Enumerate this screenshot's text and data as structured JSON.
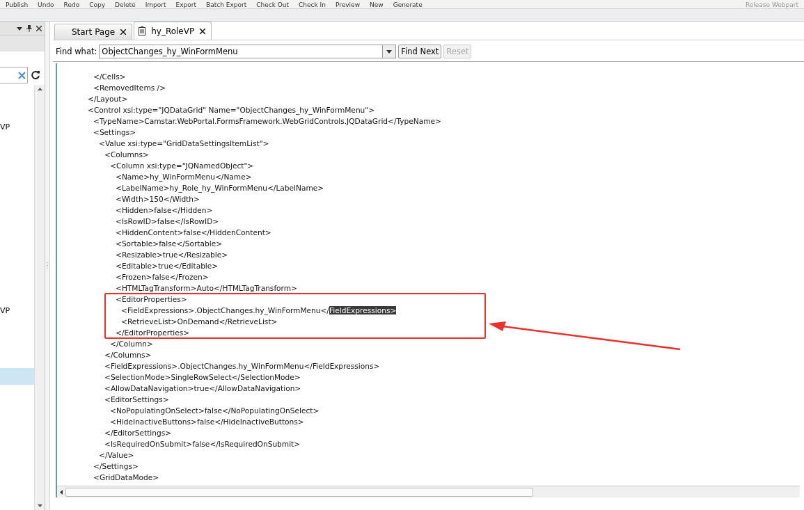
{
  "toolbar": {
    "items": [
      "Publish",
      "Undo",
      "Redo",
      "Copy",
      "Delete",
      "Import",
      "Export",
      "Batch Export",
      "Check Out",
      "Check In",
      "Preview",
      "New",
      "Generate"
    ],
    "right_item": "Release Webpart"
  },
  "side_panel": {
    "items": [
      {
        "label": "VP",
        "selected": false
      },
      {
        "label": "VP",
        "selected": false
      },
      {
        "selected": true
      }
    ]
  },
  "tabs": [
    {
      "label": "Start Page",
      "selected": false,
      "kind": "page"
    },
    {
      "label": "hy_RoleVP",
      "selected": true,
      "kind": "document"
    }
  ],
  "find_bar": {
    "label": "Find what:",
    "value": "ObjectChanges_hy_WinFormMenu",
    "buttons": [
      {
        "label": "Find Next",
        "disabled": false
      },
      {
        "label": "Reset",
        "disabled": true
      }
    ]
  },
  "code": [
    {
      "closing": "</Layout>",
      "children": [
        {
          "text": "</Cells>"
        },
        {
          "text": "<RemovedItems />"
        }
      ]
    },
    {
      "text": "<Control xsi:type=\"JQDataGrid\" Name=\"ObjectChanges_hy_WinFormMenu\">",
      "children": [
        {
          "text": "<TypeName>Camstar.WebPortal.FormsFramework.WebGridControls.JQDataGrid</TypeName>"
        },
        {
          "text": "<Settings>",
          "closing": "</Settings>",
          "children": [
            {
              "text": "<Value xsi:type=\"GridDataSettingsItemList\">",
              "closing": "</Value>",
              "children": [
                {
                  "text": "<Columns>",
                  "closing": "</Columns>",
                  "children": [
                    {
                      "text": "<Column xsi:type=\"JQNamedObject\">",
                      "closing": "</Column>",
                      "children": [
                        {
                          "text": "<Name>hy_WinFormMenu</Name>"
                        },
                        {
                          "text": "<LabelName>hy_Role_hy_WinFormMenu</LabelName>"
                        },
                        {
                          "text": "<Width>150</Width>"
                        },
                        {
                          "text": "<Hidden>false</Hidden>"
                        },
                        {
                          "text": "<IsRowID>false</IsRowID>"
                        },
                        {
                          "text": "<HiddenContent>false</HiddenContent>"
                        },
                        {
                          "text": "<Sortable>false</Sortable>"
                        },
                        {
                          "text": "<Resizable>true</Resizable>"
                        },
                        {
                          "text": "<Editable>true</Editable>"
                        },
                        {
                          "text": "<Frozen>false</Frozen>"
                        },
                        {
                          "text": "<HTMLTagTransform>Auto</HTMLTagTransform>"
                        },
                        {
                          "text": "<EditorProperties>",
                          "closing": "</EditorProperties>",
                          "annotated": true,
                          "children": [
                            {
                              "text": "<FieldExpressions>.ObjectChanges.hy_WinFormMenu</",
                              "selected_text": "FieldExpressions>"
                            },
                            {
                              "text": "<RetrieveList>OnDemand</RetrieveList>"
                            }
                          ]
                        }
                      ]
                    }
                  ]
                },
                {
                  "text": "<FieldExpressions>.ObjectChanges.hy_WinFormMenu</FieldExpressions>"
                },
                {
                  "text": "<SelectionMode>SingleRowSelect</SelectionMode>"
                },
                {
                  "text": "<AllowDataNavigation>true</AllowDataNavigation>"
                },
                {
                  "text": "<EditorSettings>",
                  "closing": "</EditorSettings>",
                  "children": [
                    {
                      "text": "<NoPopulatingOnSelect>false</NoPopulatingOnSelect>"
                    },
                    {
                      "text": "<HideInactiveButtons>false</HideInactiveButtons>"
                    }
                  ]
                },
                {
                  "text": "<IsRequiredOnSubmit>false</IsRequiredOnSubmit>"
                }
              ]
            }
          ]
        },
        {
          "text": "<GridDataMode>"
        }
      ]
    }
  ],
  "annotation": {
    "color": "#e8322b"
  }
}
